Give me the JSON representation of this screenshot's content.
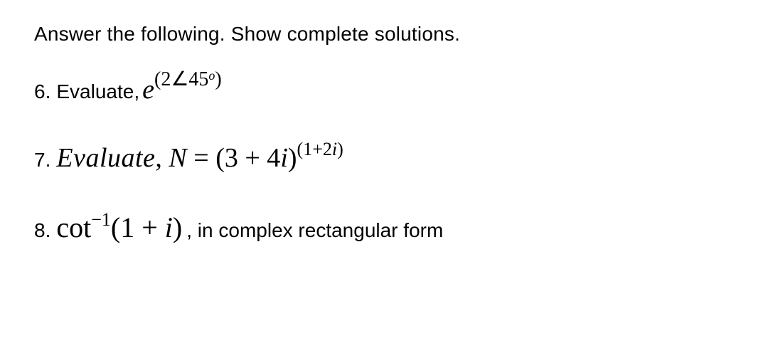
{
  "instruction": "Answer the following. Show complete solutions.",
  "problems": {
    "p6": {
      "number": "6.",
      "label": "Evaluate, ",
      "base": "e",
      "sup_open": "(",
      "sup_coef": "2",
      "sup_angle": "∠",
      "sup_deg": "45",
      "sup_degmark": "o",
      "sup_close": ")"
    },
    "p7": {
      "number": "7.",
      "eval": "Evaluate",
      "comma": ",  ",
      "N": "N",
      "eq": " = ",
      "open": "(",
      "c1": "3 + 4",
      "i1": "i",
      "close": ")",
      "sup_open": "(",
      "sup_c": "1+2",
      "sup_i": "i",
      "sup_close": ")"
    },
    "p8": {
      "number": "8.",
      "fn": "cot",
      "sup_neg": "−1",
      "open": "(",
      "c1": "1 + ",
      "i1": "i",
      "close": ")",
      "tail": " , in complex rectangular form"
    }
  }
}
